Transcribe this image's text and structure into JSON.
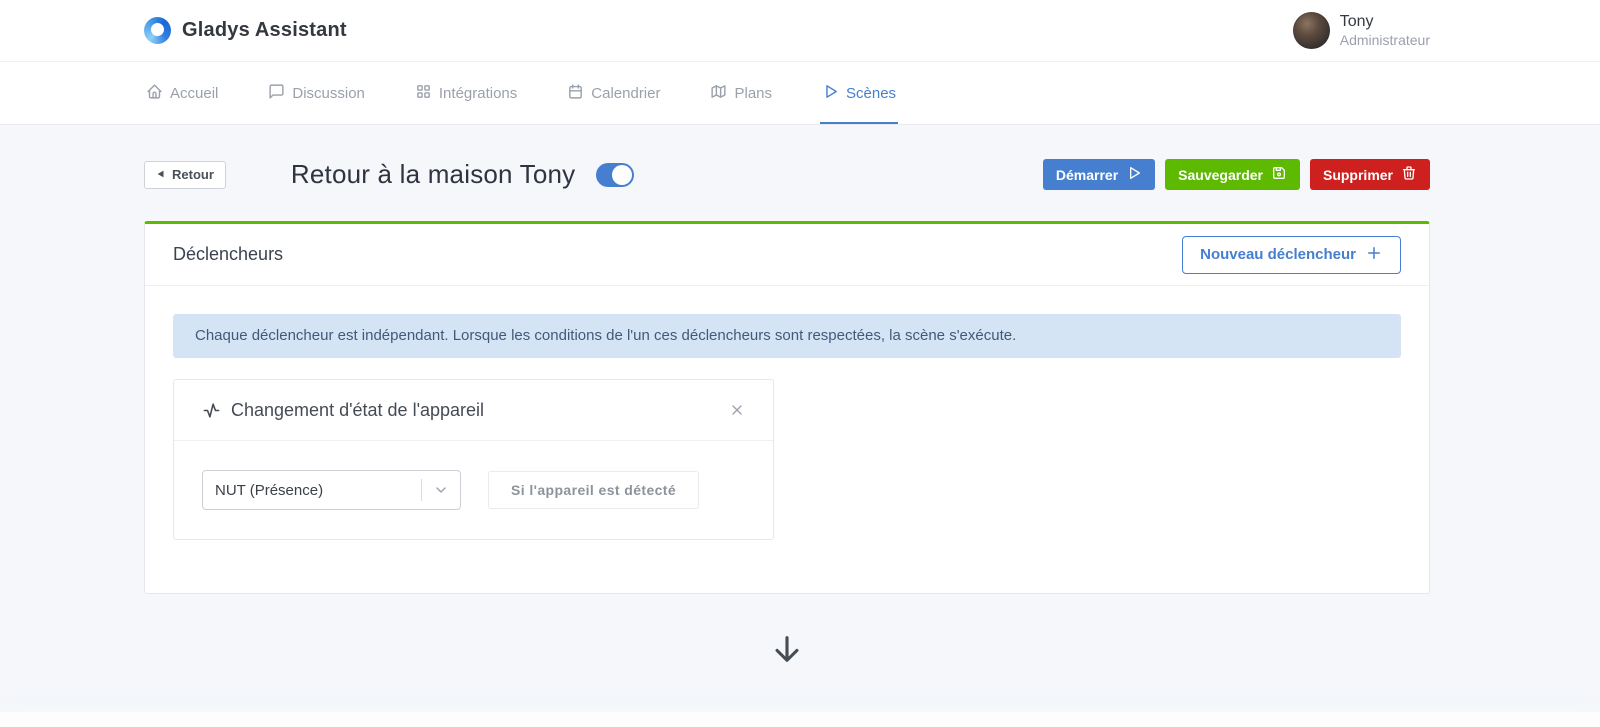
{
  "header": {
    "app_title": "Gladys Assistant",
    "user_name": "Tony",
    "user_role": "Administrateur"
  },
  "nav": {
    "items": [
      {
        "label": "Accueil",
        "icon": "home-icon",
        "active": false
      },
      {
        "label": "Discussion",
        "icon": "message-icon",
        "active": false
      },
      {
        "label": "Intégrations",
        "icon": "grid-icon",
        "active": false
      },
      {
        "label": "Calendrier",
        "icon": "calendar-icon",
        "active": false
      },
      {
        "label": "Plans",
        "icon": "map-icon",
        "active": false
      },
      {
        "label": "Scènes",
        "icon": "play-icon",
        "active": true
      }
    ]
  },
  "page": {
    "back_label": "Retour",
    "title": "Retour à la maison Tony",
    "scene_enabled": true,
    "actions": {
      "start_label": "Démarrer",
      "save_label": "Sauvegarder",
      "delete_label": "Supprimer"
    }
  },
  "triggers": {
    "card_title": "Déclencheurs",
    "new_trigger_label": "Nouveau déclencheur",
    "info_text": "Chaque déclencheur est indépendant. Lorsque les conditions de l'un ces déclencheurs sont respectées, la scène s'exécute.",
    "trigger": {
      "title": "Changement d'état de l'appareil",
      "device_value": "NUT (Présence)",
      "condition_label": "Si l'appareil est détecté"
    }
  },
  "colors": {
    "primary": "#467fcf",
    "success": "#5eba00",
    "danger": "#cd201f",
    "body_bg": "#f5f7fb",
    "card_top_border": "#5eba00",
    "alert_bg": "#d5e4f4",
    "alert_text": "#42597a",
    "nav_inactive": "#9aa0ac"
  }
}
